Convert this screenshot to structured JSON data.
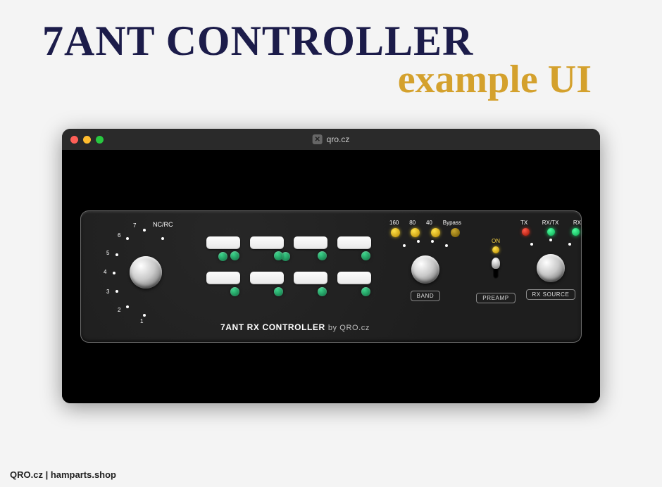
{
  "page": {
    "title_line1": "7ANT CONTROLLER",
    "title_line2": "example UI"
  },
  "browser": {
    "url": "qro.cz"
  },
  "device": {
    "name": "7ANT RX CONTROLLER",
    "by": "by QRO.cz"
  },
  "antenna_switch": {
    "label": "NC/RC",
    "positions": [
      "1",
      "2",
      "3",
      "4",
      "5",
      "6",
      "7"
    ]
  },
  "band": {
    "labels": [
      "160",
      "80",
      "40",
      "Bypass"
    ],
    "section_label": "BAND"
  },
  "preamp": {
    "on_label": "ON",
    "section_label": "PREAMP"
  },
  "rx_source": {
    "labels": [
      "TX",
      "RX/TX",
      "RX"
    ],
    "section_label": "RX SOURCE"
  },
  "footer": "QRO.cz | hamparts.shop"
}
